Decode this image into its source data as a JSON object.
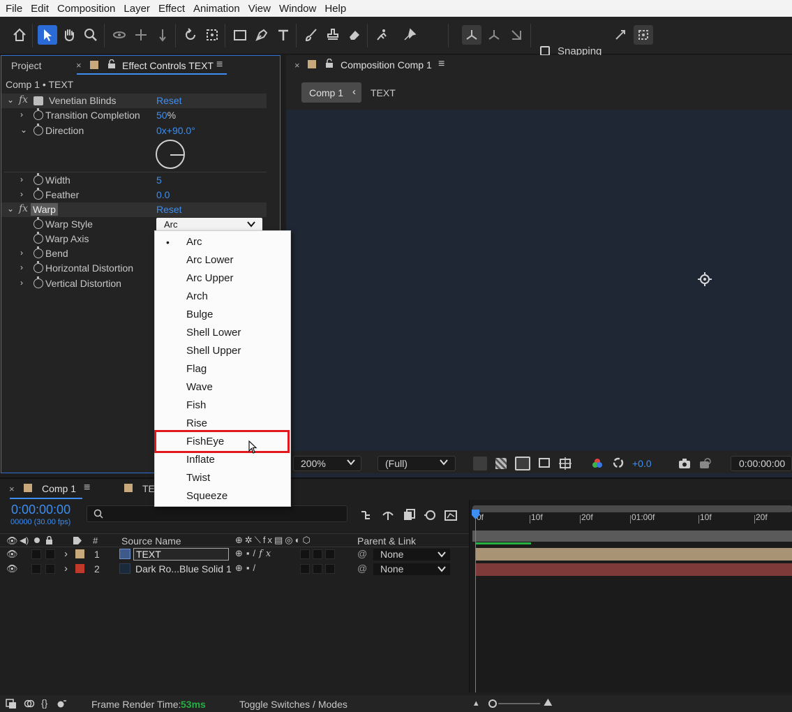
{
  "menu": [
    "File",
    "Edit",
    "Composition",
    "Layer",
    "Effect",
    "Animation",
    "View",
    "Window",
    "Help"
  ],
  "toolbar": {
    "tools": [
      "home-icon",
      "selection-arrow-icon",
      "hand-icon",
      "zoom-icon",
      "orbit-icon",
      "pan-icon",
      "dolly-icon",
      "rotate-icon",
      "pan-behind-icon",
      "rectangle-icon",
      "pen-icon",
      "type-icon",
      "brush-icon",
      "clone-stamp-icon",
      "eraser-icon",
      "roto-brush-icon",
      "puppet-pin-icon"
    ],
    "snapping_label": "Snapping"
  },
  "effect_controls": {
    "tab_project": "Project",
    "tab_effect": "Effect Controls TEXT",
    "breadcrumb": "Comp 1 • TEXT",
    "effects": [
      {
        "name": "Venetian Blinds",
        "reset": "Reset",
        "properties": [
          {
            "label": "Transition Completion",
            "value": "50",
            "unit": "%"
          },
          {
            "label": "Direction",
            "value": "0x+90.0°"
          },
          {
            "label": "Width",
            "value": "5"
          },
          {
            "label": "Feather",
            "value": "0.0"
          }
        ]
      },
      {
        "name": "Warp",
        "reset": "Reset",
        "properties": [
          {
            "label": "Warp Style",
            "value": "Arc"
          },
          {
            "label": "Warp Axis",
            "value": ""
          },
          {
            "label": "Bend",
            "value": ""
          },
          {
            "label": "Horizontal Distortion",
            "value": ""
          },
          {
            "label": "Vertical Distortion",
            "value": ""
          }
        ]
      }
    ]
  },
  "dropdown": {
    "selected": "Arc",
    "highlighted": "FishEye",
    "options": [
      "Arc",
      "Arc Lower",
      "Arc Upper",
      "Arch",
      "Bulge",
      "Shell Lower",
      "Shell Upper",
      "Flag",
      "Wave",
      "Fish",
      "Rise",
      "FishEye",
      "Inflate",
      "Twist",
      "Squeeze"
    ],
    "highlight_color": "#e1181e"
  },
  "composition": {
    "tab_title": "Composition Comp 1",
    "breadcrumb_comp": "Comp 1",
    "breadcrumb_layer": "TEXT",
    "zoom": "200%",
    "resolution": "(Full)",
    "exposure": "+0.0",
    "timecode": "0:00:00:00",
    "viewer_bg": "#1e2733"
  },
  "timeline": {
    "tab_comp": "Comp 1",
    "tab_other": "TE",
    "timecode": "0:00:00:00",
    "frame_info": "00000 (30.00 fps)",
    "search_placeholder": "",
    "col_source_name": "Source Name",
    "col_parent": "Parent & Link",
    "col_num": "#",
    "ruler_labels": [
      "0f",
      "10f",
      "20f",
      "01:00f",
      "10f",
      "20f"
    ],
    "layers": [
      {
        "index": "1",
        "name": "TEXT",
        "parent": "None",
        "label_color": "#c9a97c",
        "bar_color": "#a89474"
      },
      {
        "index": "2",
        "name": "Dark Ro...Blue Solid 1",
        "parent": "None",
        "label_color": "#c0392b",
        "bar_color": "#7e3a38"
      }
    ]
  },
  "statusbar": {
    "render_label": "Frame Render Time:",
    "render_value": "53ms",
    "toggle_label": "Toggle Switches / Modes"
  }
}
